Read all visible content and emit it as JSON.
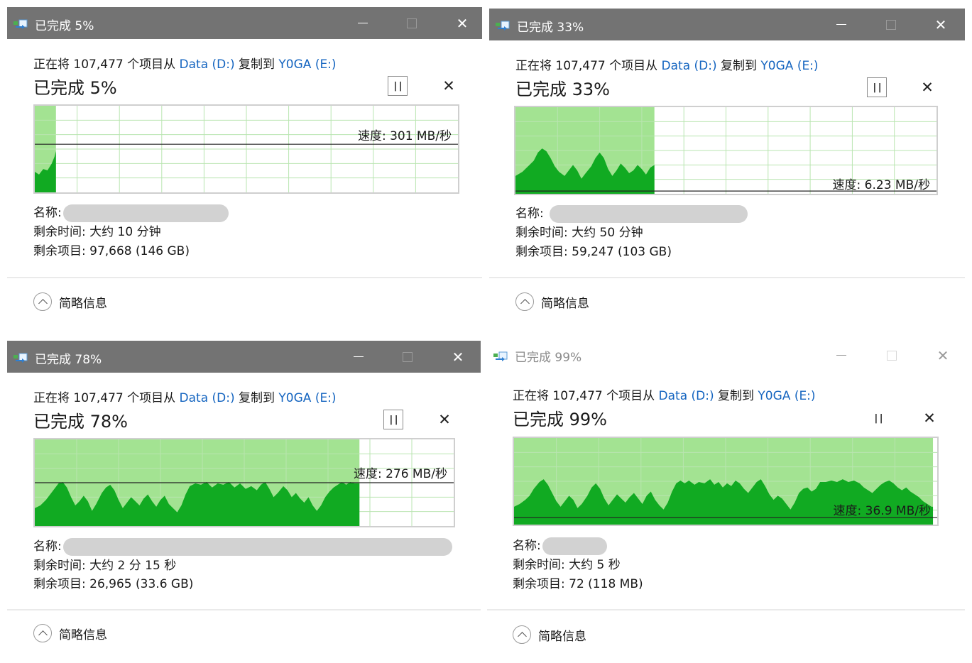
{
  "colors": {
    "titlebar_active": "#737373",
    "link": "#1565c0",
    "graph_fill": "#a3e392",
    "graph_area": "#11aa22",
    "grid": "#b9e5b0"
  },
  "dialogs": [
    {
      "title": "已完成 5%",
      "desc_prefix": "正在将 107,477 个项目从 ",
      "source": "Data (D:)",
      "desc_middle": " 复制到 ",
      "destination": "Y0GA (E:)",
      "percent_label": "已完成 5%",
      "progress": 0.05,
      "speed": "速度: 301 MB/秒",
      "name_label": "名称:",
      "remaining_time_label": "剩余时间:",
      "remaining_time": "大约 10 分钟",
      "remaining_items_label": "剩余项目:",
      "remaining_items": "97,668 (146 GB)",
      "details_label": "简略信息",
      "pause_icon": "pause-icon",
      "cancel_icon": "close-icon"
    },
    {
      "title": "已完成 33%",
      "desc_prefix": "正在将 107,477 个项目从 ",
      "source": "Data (D:)",
      "desc_middle": " 复制到 ",
      "destination": "Y0GA (E:)",
      "percent_label": "已完成 33%",
      "progress": 0.33,
      "speed": "速度: 6.23 MB/秒",
      "name_label": "名称:",
      "remaining_time_label": "剩余时间:",
      "remaining_time": "大约 50 分钟",
      "remaining_items_label": "剩余项目:",
      "remaining_items": "59,247 (103 GB)",
      "details_label": "简略信息",
      "pause_icon": "pause-icon",
      "cancel_icon": "close-icon"
    },
    {
      "title": "已完成 78%",
      "desc_prefix": "正在将 107,477 个项目从 ",
      "source": "Data (D:)",
      "desc_middle": " 复制到 ",
      "destination": "Y0GA (E:)",
      "percent_label": "已完成 78%",
      "progress": 0.78,
      "speed": "速度: 276 MB/秒",
      "name_label": "名称:",
      "remaining_time_label": "剩余时间:",
      "remaining_time": "大约 2 分 15 秒",
      "remaining_items_label": "剩余项目:",
      "remaining_items": "26,965 (33.6 GB)",
      "details_label": "简略信息",
      "pause_icon": "pause-icon",
      "cancel_icon": "close-icon"
    },
    {
      "title": "已完成 99%",
      "desc_prefix": "正在将 107,477 个项目从 ",
      "source": "Data (D:)",
      "desc_middle": " 复制到 ",
      "destination": "Y0GA (E:)",
      "percent_label": "已完成 99%",
      "progress": 0.99,
      "speed": "速度: 36.9 MB/秒",
      "name_label": "名称:",
      "remaining_time_label": "剩余时间:",
      "remaining_time": "大约 5 秒",
      "remaining_items_label": "剩余项目:",
      "remaining_items": "72 (118 MB)",
      "details_label": "简略信息",
      "pause_icon": "pause-icon",
      "cancel_icon": "close-icon"
    }
  ]
}
